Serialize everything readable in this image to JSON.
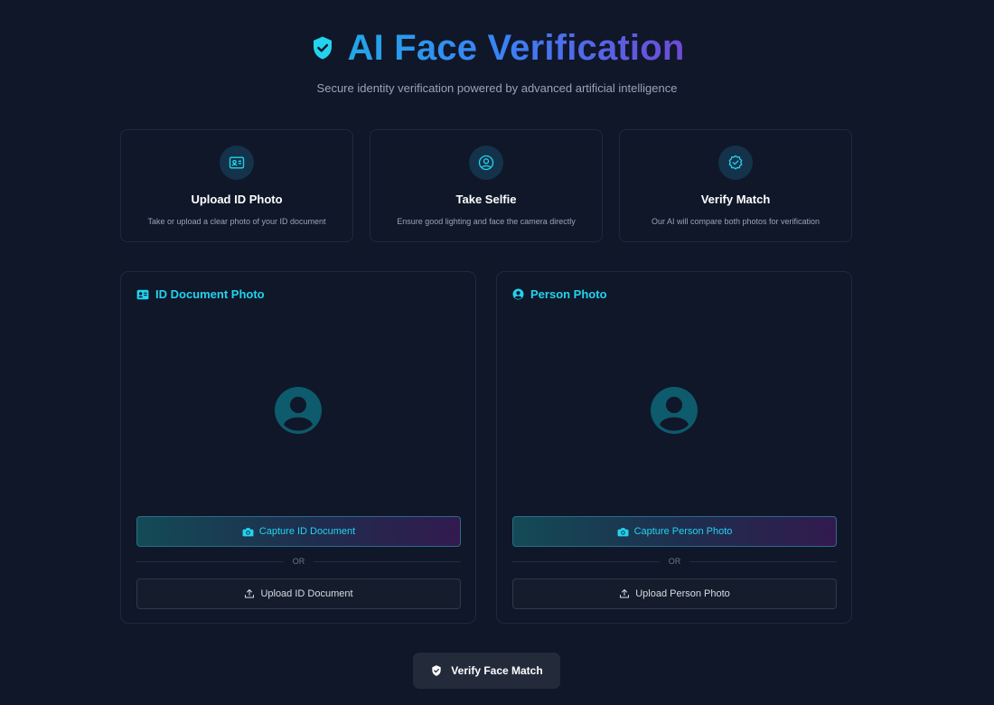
{
  "header": {
    "title": "AI Face Verification",
    "subtitle": "Secure identity verification powered by advanced artificial intelligence",
    "icon": "shield-check-icon"
  },
  "steps": [
    {
      "icon": "id-card-icon",
      "title": "Upload ID Photo",
      "desc": "Take or upload a clear photo of your ID document"
    },
    {
      "icon": "user-circle-icon",
      "title": "Take Selfie",
      "desc": "Ensure good lighting and face the camera directly"
    },
    {
      "icon": "check-circle-icon",
      "title": "Verify Match",
      "desc": "Our AI will compare both photos for verification"
    }
  ],
  "panels": {
    "id_document": {
      "icon": "id-card-icon",
      "title": "ID Document Photo",
      "placeholder_icon": "avatar-placeholder-icon",
      "capture_label": "Capture ID Document",
      "or_label": "OR",
      "upload_label": "Upload ID Document"
    },
    "person": {
      "icon": "user-circle-icon",
      "title": "Person Photo",
      "placeholder_icon": "avatar-placeholder-icon",
      "capture_label": "Capture Person Photo",
      "or_label": "OR",
      "upload_label": "Upload Person Photo"
    }
  },
  "verify": {
    "icon": "shield-check-icon",
    "label": "Verify Face Match"
  },
  "colors": {
    "background": "#0f1729",
    "accent": "#22d3ee",
    "title_gradient_start": "#22a7e6",
    "title_gradient_end": "#6d4bd6"
  }
}
